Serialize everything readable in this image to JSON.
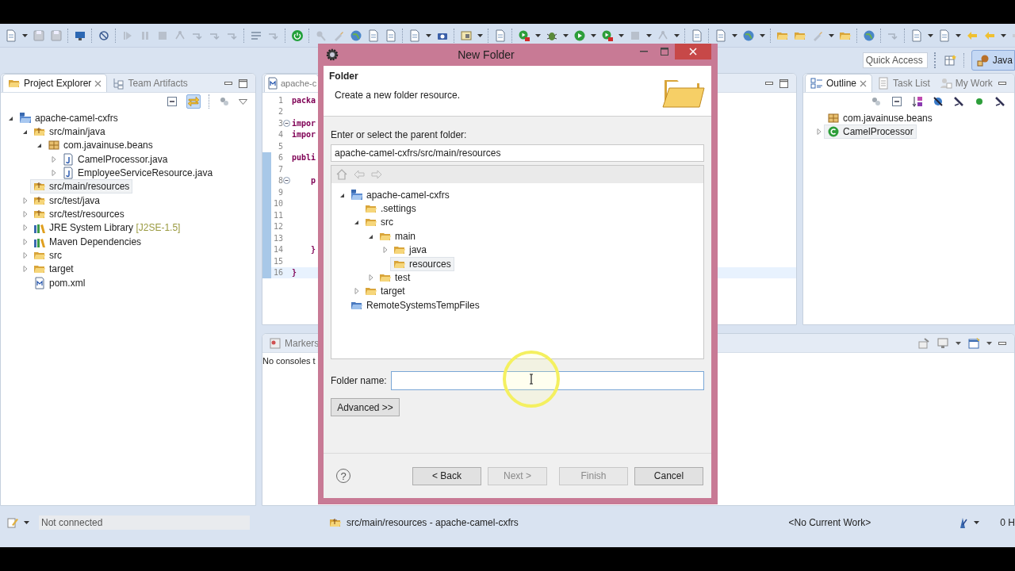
{
  "toolbar": {
    "quick_access": "Quick Access",
    "perspective": {
      "label": "Java",
      "selected": true
    }
  },
  "project_explorer": {
    "tabs": [
      {
        "label": "Project Explorer",
        "selected": true
      },
      {
        "label": "Team Artifacts",
        "selected": false
      }
    ],
    "tree": [
      {
        "label": "apache-camel-cxfrs",
        "kind": "project",
        "expanded": true,
        "selected": false,
        "children": [
          {
            "label": "src/main/java",
            "kind": "source-folder",
            "expanded": true,
            "selected": false,
            "children": [
              {
                "label": "com.javainuse.beans",
                "kind": "package",
                "expanded": true,
                "selected": false,
                "children": [
                  {
                    "label": "CamelProcessor.java",
                    "kind": "java-file",
                    "expanded": false,
                    "selected": false
                  },
                  {
                    "label": "EmployeeServiceResource.java",
                    "kind": "java-file",
                    "expanded": false,
                    "selected": false
                  }
                ]
              }
            ]
          },
          {
            "label": "src/main/resources",
            "kind": "source-folder",
            "selected": true
          },
          {
            "label": "src/test/java",
            "kind": "source-folder",
            "expanded": false,
            "selected": false
          },
          {
            "label": "src/test/resources",
            "kind": "source-folder",
            "expanded": false,
            "selected": false
          },
          {
            "label": "JRE System Library",
            "decoration": "[J2SE-1.5]",
            "kind": "library",
            "expanded": false,
            "selected": false
          },
          {
            "label": "Maven Dependencies",
            "kind": "library",
            "expanded": false,
            "selected": false
          },
          {
            "label": "src",
            "kind": "folder",
            "expanded": false,
            "selected": false
          },
          {
            "label": "target",
            "kind": "folder",
            "expanded": false,
            "selected": false
          },
          {
            "label": "pom.xml",
            "kind": "xml-file",
            "selected": false
          }
        ]
      }
    ]
  },
  "editor": {
    "tab": "apache-c",
    "lines": [
      {
        "number": "1",
        "code": "packa",
        "fold": false,
        "in_range": false,
        "current": false
      },
      {
        "number": "2",
        "fold": false,
        "in_range": false,
        "current": false
      },
      {
        "number": "3",
        "code": "impor",
        "fold": true,
        "in_range": false,
        "current": false
      },
      {
        "number": "4",
        "code": "impor",
        "fold": false,
        "in_range": false,
        "current": false
      },
      {
        "number": "5",
        "fold": false,
        "in_range": false,
        "current": false
      },
      {
        "number": "6",
        "code": "publi",
        "fold": false,
        "in_range": true,
        "current": false
      },
      {
        "number": "7",
        "fold": false,
        "in_range": true,
        "current": false
      },
      {
        "number": "8",
        "code": "    p",
        "fold": true,
        "in_range": true,
        "current": false
      },
      {
        "number": "9",
        "fold": false,
        "in_range": true,
        "current": false
      },
      {
        "number": "10",
        "fold": false,
        "in_range": true,
        "current": false
      },
      {
        "number": "11",
        "fold": false,
        "in_range": true,
        "current": false
      },
      {
        "number": "12",
        "fold": false,
        "in_range": true,
        "current": false
      },
      {
        "number": "13",
        "fold": false,
        "in_range": true,
        "current": false
      },
      {
        "number": "14",
        "code": "    }",
        "fold": false,
        "in_range": true,
        "current": false
      },
      {
        "number": "15",
        "fold": false,
        "in_range": true,
        "current": false
      },
      {
        "number": "16",
        "code": "}",
        "fold": false,
        "in_range": true,
        "current": true
      }
    ]
  },
  "outline": {
    "tabs": [
      {
        "label": "Outline",
        "selected": true
      },
      {
        "label": "Task List",
        "selected": false
      },
      {
        "label": "My Work",
        "selected": false
      }
    ],
    "items": [
      {
        "label": "com.javainuse.beans",
        "kind": "package",
        "selected": false
      },
      {
        "label": "CamelProcessor",
        "kind": "class",
        "expanded": false,
        "selected": true
      }
    ]
  },
  "console": {
    "tabs": [
      {
        "label": "Markers",
        "selected": false
      }
    ],
    "message": "No consoles t"
  },
  "status_bar": {
    "connection": "Not connected",
    "selection": "src/main/resources - apache-camel-cxfrs",
    "work": "<No Current Work>",
    "trailing": "0 H"
  },
  "dialog": {
    "title": "New Folder",
    "heading": "Folder",
    "description": "Create a new folder resource.",
    "parent_label": "Enter or select the parent folder:",
    "parent_value": "apache-camel-cxfrs/src/main/resources",
    "tree": [
      {
        "label": "apache-camel-cxfrs",
        "kind": "project",
        "expanded": true,
        "selected": false,
        "children": [
          {
            "label": ".settings",
            "kind": "folder",
            "selected": false
          },
          {
            "label": "src",
            "kind": "folder",
            "expanded": true,
            "selected": false,
            "children": [
              {
                "label": "main",
                "kind": "folder",
                "expanded": true,
                "selected": false,
                "children": [
                  {
                    "label": "java",
                    "kind": "folder",
                    "expanded": false,
                    "selected": false
                  },
                  {
                    "label": "resources",
                    "kind": "folder",
                    "selected": true
                  }
                ]
              },
              {
                "label": "test",
                "kind": "folder",
                "expanded": false,
                "selected": false
              }
            ]
          },
          {
            "label": "target",
            "kind": "folder",
            "expanded": false,
            "selected": false
          }
        ]
      },
      {
        "label": "RemoteSystemsTempFiles",
        "kind": "remote-folder",
        "selected": false
      }
    ],
    "name_label": "Folder name:",
    "advanced": "Advanced >>",
    "help": "?",
    "buttons": [
      {
        "label": "< Back",
        "disabled": false
      },
      {
        "label": "Next >",
        "disabled": true
      },
      {
        "label": "Finish",
        "disabled": true
      },
      {
        "label": "Cancel",
        "disabled": false
      }
    ]
  }
}
